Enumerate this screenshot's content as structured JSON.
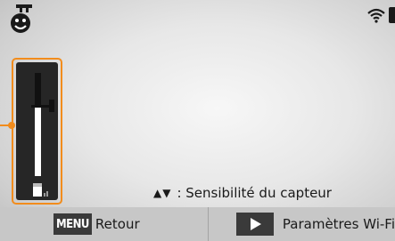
{
  "status": {
    "face_icon": "smart-face-icon",
    "wifi_icon": "wifi-icon",
    "battery_icon": "battery-icon"
  },
  "sensor": {
    "icon": "sensor-sensitivity-icon",
    "level_fraction": 0.68
  },
  "hint": {
    "arrows": "▲▼",
    "text": ": Sensibilité du capteur"
  },
  "bottom_bar": {
    "menu_key": "MENU",
    "back_label": "Retour",
    "play_icon": "play-icon",
    "wifi_settings_label": "Paramètres Wi-Fi"
  },
  "colors": {
    "accent": "#f28c1c",
    "bar_background": "#c7c7c7"
  }
}
